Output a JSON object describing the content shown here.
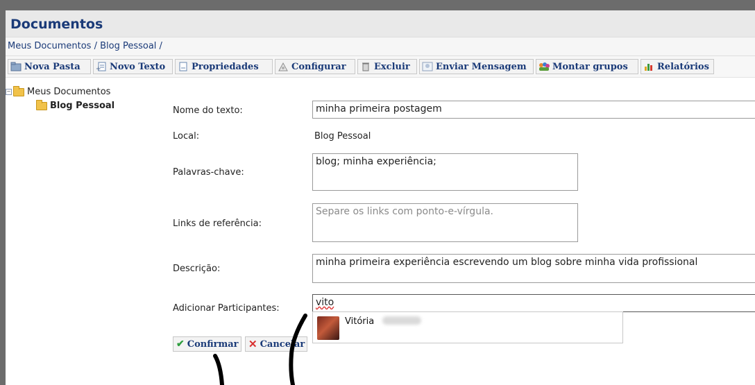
{
  "header": {
    "title": "Documentos"
  },
  "breadcrumb": {
    "text": "Meus Documentos / Blog Pessoal /"
  },
  "toolbar": {
    "buttons": [
      {
        "label": "Nova Pasta",
        "icon": "new-folder-icon"
      },
      {
        "label": "Novo Texto",
        "icon": "new-text-icon"
      },
      {
        "label": "Propriedades",
        "icon": "properties-icon"
      },
      {
        "label": "Configurar",
        "icon": "configure-icon"
      },
      {
        "label": "Excluir",
        "icon": "trash-icon"
      },
      {
        "label": "Enviar Mensagem",
        "icon": "send-message-icon"
      },
      {
        "label": "Montar grupos",
        "icon": "groups-icon"
      },
      {
        "label": "Relatórios",
        "icon": "reports-icon"
      }
    ]
  },
  "tree": {
    "root": "Meus Documentos",
    "child": "Blog Pessoal"
  },
  "form": {
    "name_label": "Nome do texto:",
    "name_value": "minha primeira postagem",
    "local_label": "Local:",
    "local_value": "Blog Pessoal",
    "keywords_label": "Palavras-chave:",
    "keywords_value": "blog; minha experiência;",
    "links_label": "Links de referência:",
    "links_placeholder": "Separe os links com ponto-e-vírgula.",
    "description_label": "Descrição:",
    "description_value": "minha primeira experiência escrevendo um blog sobre minha vida profissional",
    "participants_label": "Adicionar Participantes:",
    "participants_value": "vito",
    "suggestion_name": "Vitória"
  },
  "actions": {
    "confirm": "Confirmar",
    "cancel": "Cancelar"
  },
  "colors": {
    "title": "#1a3a78",
    "confirm_icon": "#2f9e3f",
    "cancel_icon": "#d9302f"
  }
}
